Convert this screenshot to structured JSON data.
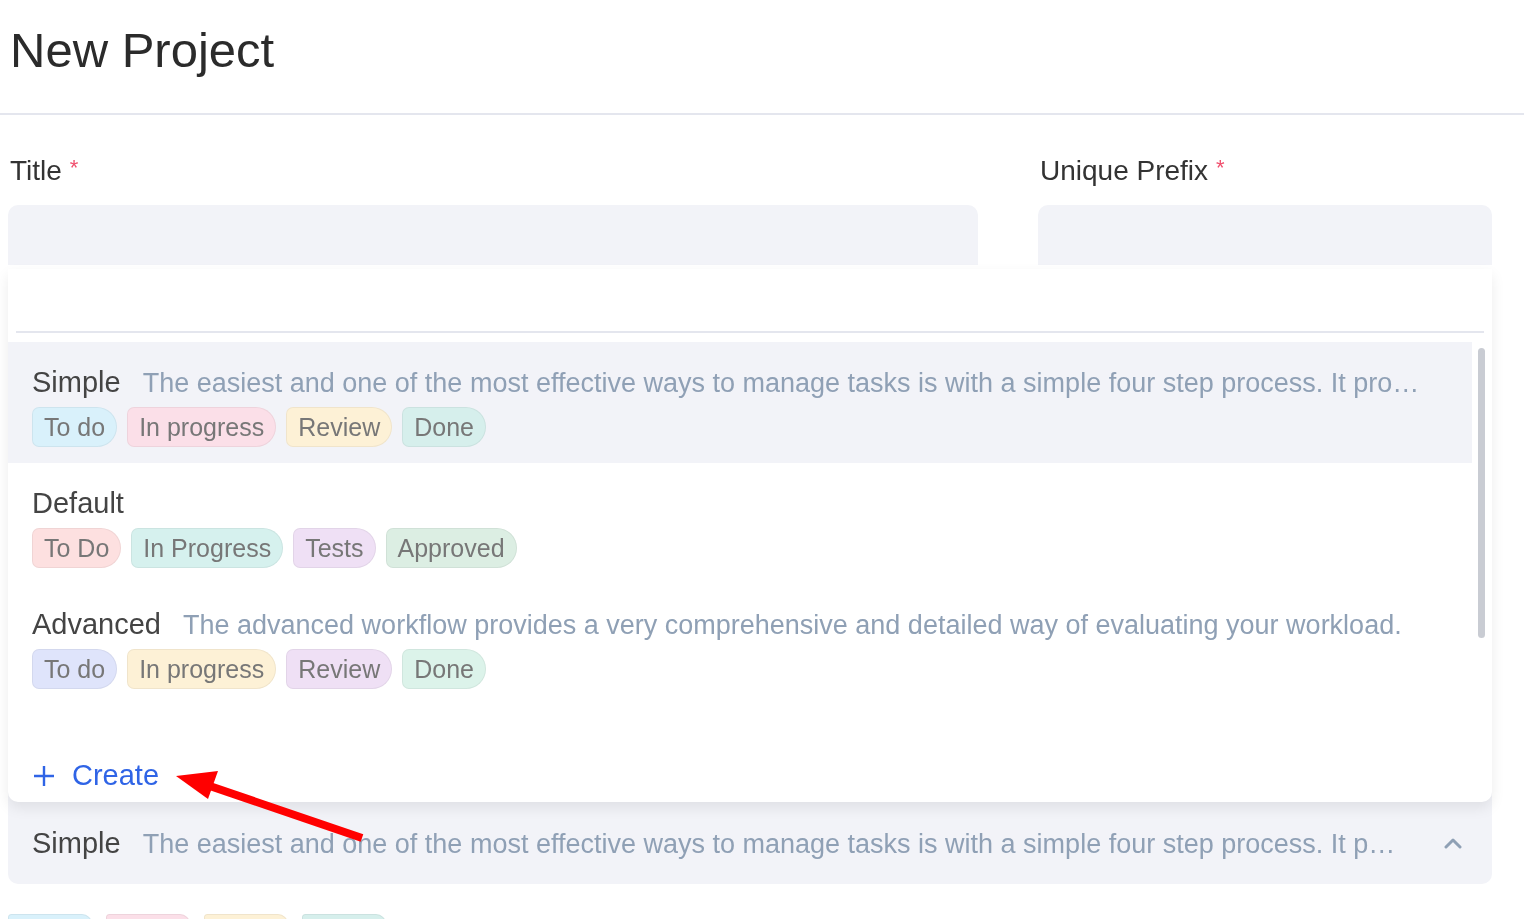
{
  "page": {
    "title": "New Project"
  },
  "fields": [
    {
      "label": "Title",
      "required_mark": "*"
    },
    {
      "label": "Unique Prefix",
      "required_mark": "*"
    }
  ],
  "workflow_dropdown": {
    "options": [
      {
        "name": "Simple",
        "description": "The easiest and one of the most effective ways to manage tasks is with a simple four step process. It pro…",
        "highlighted": true,
        "tags": [
          {
            "label": "To do",
            "color": "#d9f1fb"
          },
          {
            "label": "In progress",
            "color": "#fbdfe8"
          },
          {
            "label": "Review",
            "color": "#fdf1d6"
          },
          {
            "label": "Done",
            "color": "#d6efec"
          }
        ]
      },
      {
        "name": "Default",
        "highlighted": false,
        "tags": [
          {
            "label": "To Do",
            "color": "#fde0e0"
          },
          {
            "label": "In Progress",
            "color": "#d6f1ee"
          },
          {
            "label": "Tests",
            "color": "#efe0f5"
          },
          {
            "label": "Approved",
            "color": "#dceee3"
          }
        ]
      },
      {
        "name": "Advanced",
        "description": "The advanced workflow provides a very comprehensive and detailed way of evaluating your workload.",
        "highlighted": false,
        "tags": [
          {
            "label": "To do",
            "color": "#dfe4fb"
          },
          {
            "label": "In progress",
            "color": "#fdf1d6"
          },
          {
            "label": "Review",
            "color": "#efe0f5"
          },
          {
            "label": "Done",
            "color": "#dcf3ea"
          }
        ]
      }
    ],
    "create_label": "Create"
  },
  "workflow_select": {
    "name": "Simple",
    "description": "The easiest and one of the most effective ways to manage tasks is with a simple four step process. It p…",
    "expanded": true
  },
  "selected_tags": [
    {
      "color": "#d9f1fb"
    },
    {
      "color": "#fbdfe8"
    },
    {
      "color": "#fdf1d6"
    },
    {
      "color": "#d6efec"
    }
  ]
}
